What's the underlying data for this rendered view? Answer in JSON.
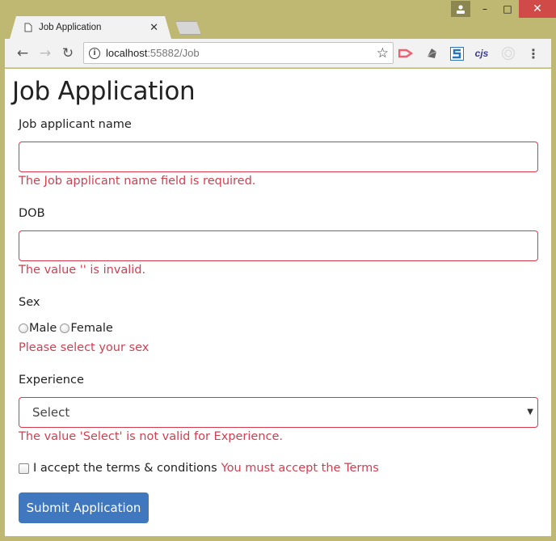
{
  "window": {
    "minimize": "–",
    "maximize": "□",
    "close": "✕"
  },
  "tab": {
    "title": "Job Application",
    "close": "✕"
  },
  "toolbar": {
    "back": "←",
    "forward": "→",
    "reload": "↻",
    "url_host": "localhost",
    "url_rest": ":55882/Job",
    "star": "☆",
    "info": "i",
    "ext_cjs": "cjs",
    "menu": "⋮"
  },
  "page": {
    "title": "Job Application",
    "name": {
      "label": "Job applicant name",
      "value": "",
      "error": "The Job applicant name field is required."
    },
    "dob": {
      "label": "DOB",
      "value": "",
      "error": "The value '' is invalid."
    },
    "sex": {
      "label": "Sex",
      "options": [
        "Male",
        "Female"
      ],
      "error": "Please select your sex"
    },
    "experience": {
      "label": "Experience",
      "selected": "Select",
      "error": "The value 'Select' is not valid for Experience."
    },
    "terms": {
      "label": "I accept the terms & conditions",
      "error": "You must accept the Terms"
    },
    "submit_label": "Submit Application"
  },
  "colors": {
    "error": "#d04050",
    "primary": "#4078c0",
    "frame": "#bfb872"
  }
}
